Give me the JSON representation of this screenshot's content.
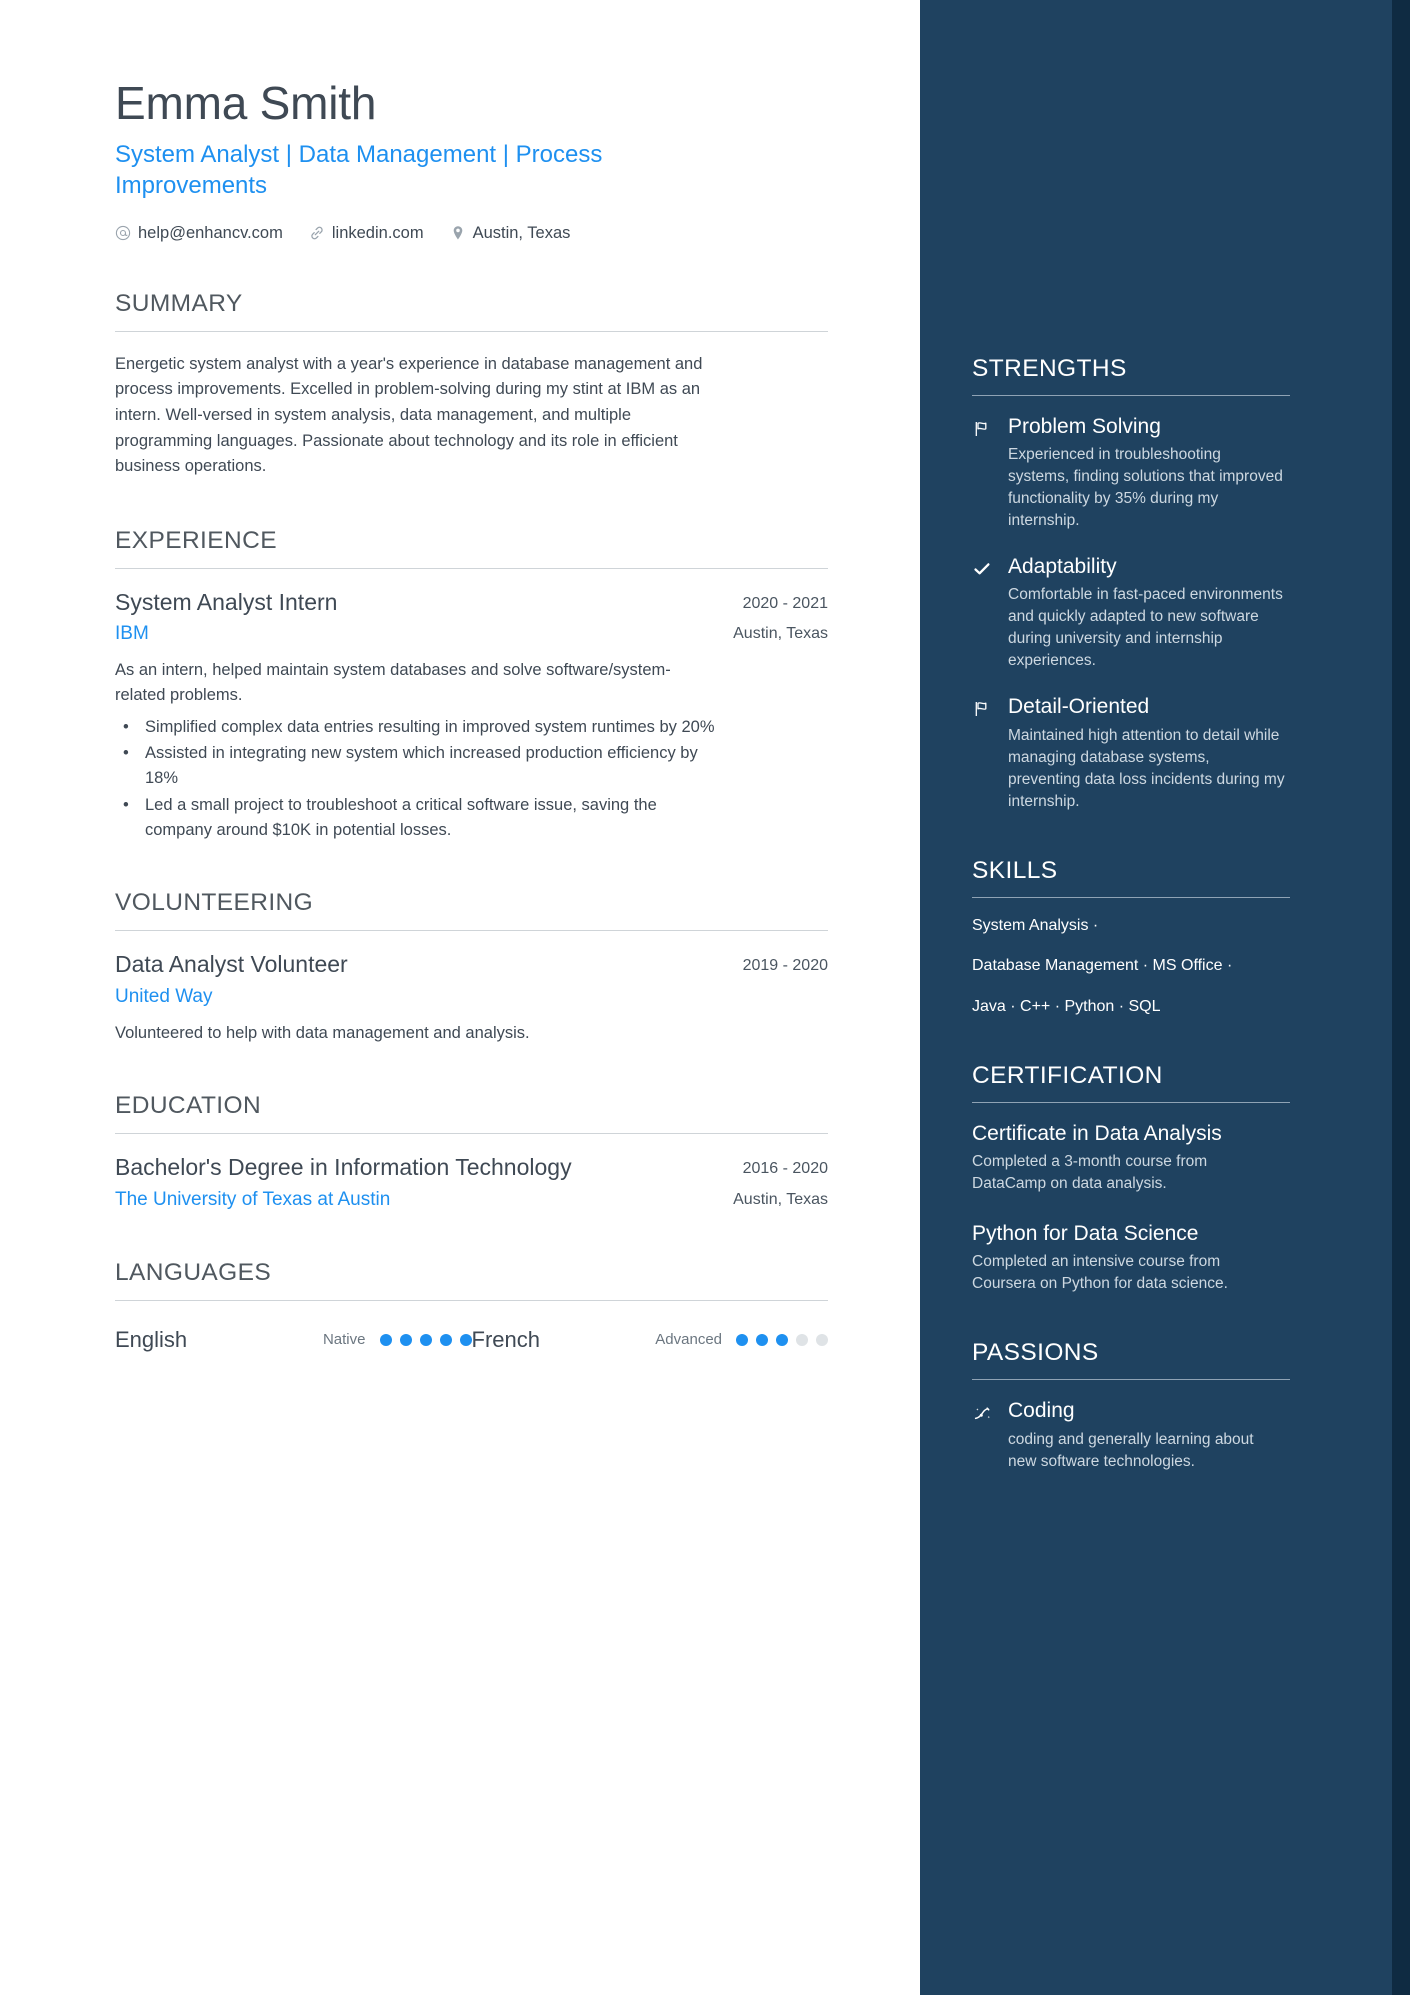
{
  "theme": {
    "accent_blue": "#1e90f0",
    "sidebar_bg": "#1f4260",
    "sidebar_edge": "#0f2b42",
    "text_dark": "#3f4954"
  },
  "header": {
    "name": "Emma Smith",
    "headline": "System Analyst | Data Management | Process Improvements",
    "contacts": [
      {
        "icon": "at-icon",
        "text": "help@enhancv.com"
      },
      {
        "icon": "link-icon",
        "text": "linkedin.com"
      },
      {
        "icon": "location-pin-icon",
        "text": "Austin, Texas"
      }
    ]
  },
  "sections": {
    "summary": {
      "title": "SUMMARY",
      "text": "Energetic system analyst with a year's experience in database management and process improvements. Excelled in problem-solving during my stint at IBM as an intern. Well-versed in system analysis, data management, and multiple programming languages. Passionate about technology and its role in efficient business operations."
    },
    "experience": {
      "title": "EXPERIENCE",
      "entries": [
        {
          "title": "System Analyst Intern",
          "org": "IBM",
          "dates": "2020 - 2021",
          "location": "Austin, Texas",
          "description": "As an intern, helped maintain system databases and solve software/system-related problems.",
          "bullets": [
            "Simplified complex data entries resulting in improved system runtimes by 20%",
            "Assisted in integrating new system which increased production efficiency by 18%",
            "Led a small project to troubleshoot a critical software issue, saving the company around $10K in potential losses."
          ]
        }
      ]
    },
    "volunteering": {
      "title": "VOLUNTEERING",
      "entries": [
        {
          "title": "Data Analyst Volunteer",
          "org": "United Way",
          "dates": "2019 - 2020",
          "location": "",
          "description": "Volunteered to help with data management and analysis.",
          "bullets": []
        }
      ]
    },
    "education": {
      "title": "EDUCATION",
      "entries": [
        {
          "title": "Bachelor's Degree in Information Technology",
          "org": "The University of Texas at Austin",
          "dates": "2016 - 2020",
          "location": "Austin, Texas"
        }
      ]
    },
    "languages": {
      "title": "LANGUAGES",
      "items": [
        {
          "name": "English",
          "level": "Native",
          "filled": 5,
          "total": 5
        },
        {
          "name": "French",
          "level": "Advanced",
          "filled": 3,
          "total": 5
        }
      ]
    }
  },
  "sidebar": {
    "strengths": {
      "title": "STRENGTHS",
      "items": [
        {
          "icon": "flag-icon",
          "name": "Problem Solving",
          "desc": "Experienced in troubleshooting systems, finding solutions that improved functionality by 35% during my internship."
        },
        {
          "icon": "check-icon",
          "name": "Adaptability",
          "desc": "Comfortable in fast-paced environments and quickly adapted to new software during university and internship experiences."
        },
        {
          "icon": "flag-icon",
          "name": "Detail-Oriented",
          "desc": "Maintained high attention to detail while managing database systems, preventing data loss incidents during my internship."
        }
      ]
    },
    "skills": {
      "title": "SKILLS",
      "lines": [
        "System Analysis ·",
        "Database Management · MS Office ·",
        "Java · C++ · Python · SQL"
      ]
    },
    "certification": {
      "title": "CERTIFICATION",
      "items": [
        {
          "name": "Certificate in Data Analysis",
          "desc": "Completed a 3-month course from DataCamp on data analysis."
        },
        {
          "name": "Python for Data Science",
          "desc": "Completed an intensive course from Coursera on Python for data science."
        }
      ]
    },
    "passions": {
      "title": "PASSIONS",
      "items": [
        {
          "icon": "rocket-icon",
          "name": "Coding",
          "desc": " coding and generally learning about new software technologies."
        }
      ]
    }
  }
}
